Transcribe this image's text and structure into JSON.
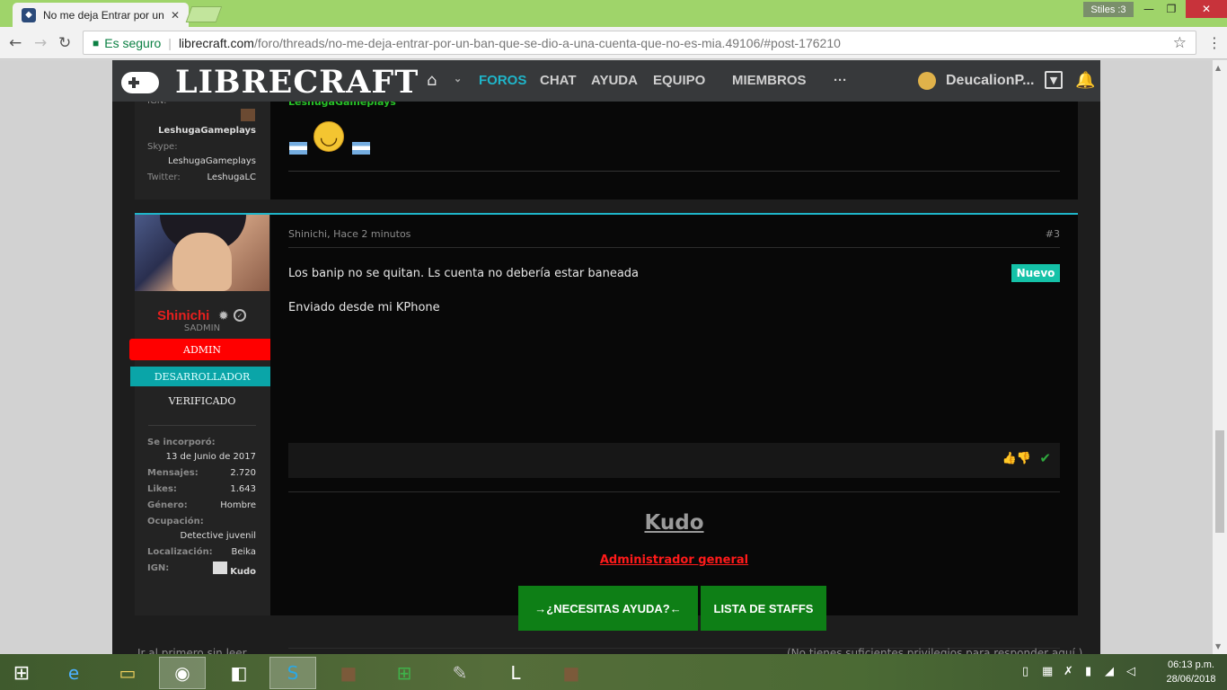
{
  "browser": {
    "tab_title": "No me deja Entrar por un",
    "tab_close": "✕",
    "profile_name": "Stiles :3",
    "secure_label": "Es seguro",
    "url_domain": "librecraft.com",
    "url_path": "/foro/threads/no-me-deja-entrar-por-un-ban-que-se-dio-a-una-cuenta-que-no-es-mia.49106/#post-176210"
  },
  "site_nav": {
    "logo": "LIBRECRAFT",
    "items": [
      "FOROS",
      "CHAT",
      "AYUDA",
      "EQUIPO",
      "MIEMBROS",
      "···"
    ],
    "username": "DeucalionP..."
  },
  "prev_post": {
    "ign_label": "IGN:",
    "ign_value": "LeshugaGameplays",
    "skype_label": "Skype:",
    "skype_value": "LeshugaGameplays",
    "twitter_label": "Twitter:",
    "twitter_value": "LeshugaLC",
    "green_text": "LeshugaGameplays"
  },
  "post": {
    "username": "Shinichi",
    "user_title": "SADMIN",
    "banners": [
      "ADMIN",
      "DESARROLLADOR",
      "VERIFICADO"
    ],
    "stats": [
      {
        "label": "Se incorporó:",
        "value": "13 de Junio de 2017"
      },
      {
        "label": "Mensajes:",
        "value": "2.720"
      },
      {
        "label": "Likes:",
        "value": "1.643"
      },
      {
        "label": "Género:",
        "value": "Hombre"
      },
      {
        "label": "Ocupación:",
        "value": "Detective juvenil"
      },
      {
        "label": "Localización:",
        "value": "Beika"
      },
      {
        "label": "IGN:",
        "value": "Kudo"
      }
    ],
    "meta": "Shinichi, Hace 2 minutos",
    "number": "#3",
    "body_line1": "Los banip no se quitan. Ls cuenta no debería estar baneada",
    "body_line2": "Enviado desde mi KPhone",
    "badge_new": "Nuevo",
    "signature": {
      "name": "Kudo",
      "role": "Administrador general",
      "help_button": "→¿NECESITAS AYUDA?←",
      "staff_button": "LISTA DE STAFFS"
    }
  },
  "footer": {
    "left": "Ir al primero sin leer",
    "right": "(No tienes suficientes privilegios para responder aquí.)"
  },
  "taskbar": {
    "time": "06:13 p.m.",
    "date": "28/06/2018"
  },
  "colors": {
    "accent": "#1fb5c9",
    "admin_red": "#ff0000",
    "dev_teal": "#0aa5a8",
    "new_badge": "#15c2a8",
    "button_green": "#0e7f16"
  }
}
